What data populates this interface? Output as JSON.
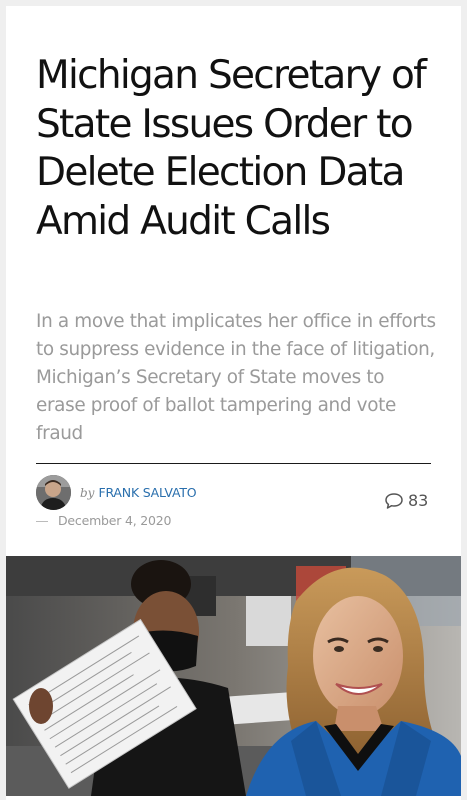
{
  "article": {
    "title": "Michigan Secretary of State Issues Order to Delete Election Data Amid Audit Calls",
    "subtitle": "In a move that implicates her office in efforts to suppress evidence in the face of litigation, Michigan’s Secretary of State moves to erase proof of ballot tampering and vote fraud",
    "byline": {
      "prefix": "by",
      "author": "FRANK SALVATO"
    },
    "comments": {
      "count": "83",
      "icon": "speech-bubble-icon"
    },
    "date": "December 4, 2020",
    "hero_image": {
      "alt": "Election workers handling ballots beside a smiling woman in a blue blazer"
    }
  },
  "colors": {
    "title": "#111111",
    "subtitle": "#9a9a9a",
    "author_link": "#2a6fad",
    "background": "#efefef",
    "card": "#ffffff",
    "blazer": "#1f62b0"
  }
}
